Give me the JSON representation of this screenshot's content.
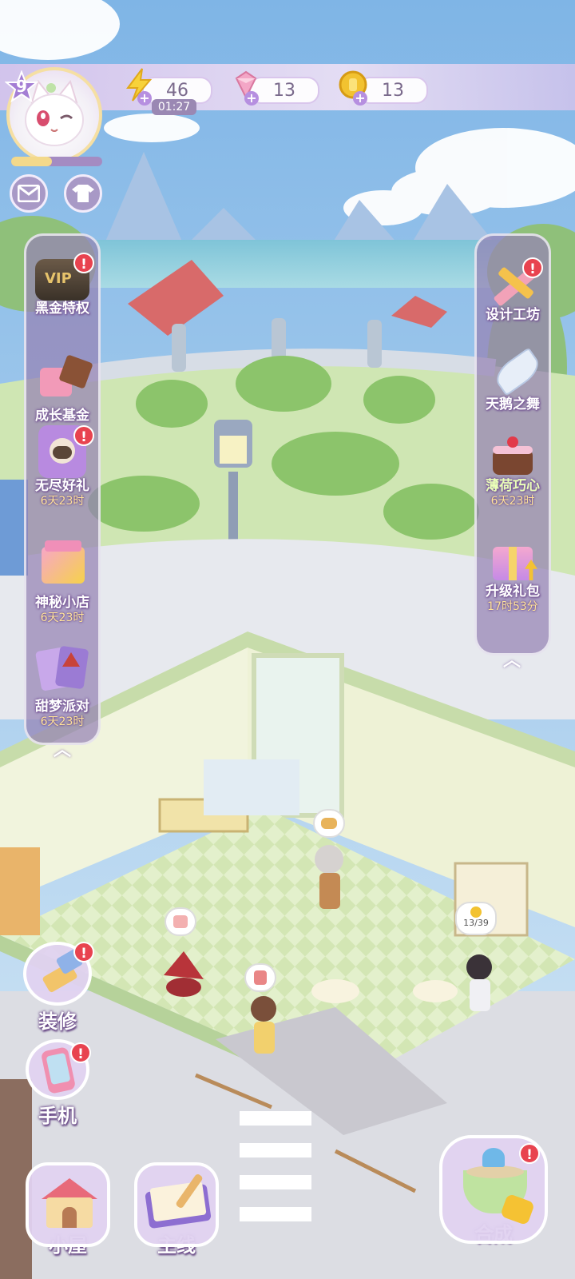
{
  "colors": {
    "accent": "#b68fe0",
    "badge": "#e8434f",
    "timer_text": "#ffe49a",
    "panel": "#9682b4"
  },
  "player": {
    "level": "9",
    "xp_fraction": 0.45
  },
  "resources": {
    "energy": {
      "value": "46",
      "timer": "01:27",
      "icon": "lightning-icon"
    },
    "gems": {
      "value": "13",
      "icon": "gem-icon"
    },
    "coins": {
      "value": "13",
      "icon": "coin-icon"
    }
  },
  "left_panel": {
    "items": [
      {
        "label": "黑金特权",
        "timer": "",
        "icon": "vip-card-icon",
        "badge": "!"
      },
      {
        "label": "成长基金",
        "timer": "",
        "icon": "gift-cake-icon",
        "badge": ""
      },
      {
        "label": "无尽好礼",
        "timer": "6天23时",
        "icon": "cat-card-icon",
        "badge": "!"
      },
      {
        "label": "神秘小店",
        "timer": "6天23时",
        "icon": "mystery-box-icon",
        "badge": ""
      },
      {
        "label": "甜梦派对",
        "timer": "6天23时",
        "icon": "party-cards-icon",
        "badge": ""
      }
    ]
  },
  "right_panel": {
    "items": [
      {
        "label": "设计工坊",
        "timer": "",
        "icon": "pencil-ruler-icon",
        "badge": "!"
      },
      {
        "label": "天鹅之舞",
        "timer": "",
        "icon": "feather-icon",
        "badge": ""
      },
      {
        "label": "薄荷巧心",
        "timer": "6天23时",
        "icon": "chocolate-cake-icon",
        "badge": ""
      },
      {
        "label": "升级礼包",
        "timer": "17时53分",
        "icon": "upgrade-gift-icon",
        "badge": ""
      }
    ]
  },
  "scene": {
    "customer_bubble": "13/39"
  },
  "bottom": {
    "decorate": {
      "label": "装修",
      "badge": "!"
    },
    "phone": {
      "label": "手机",
      "badge": "!"
    },
    "house": {
      "label": "小屋"
    },
    "main_story": {
      "label": "主线"
    },
    "merge": {
      "label": "合成",
      "badge": "!"
    }
  }
}
